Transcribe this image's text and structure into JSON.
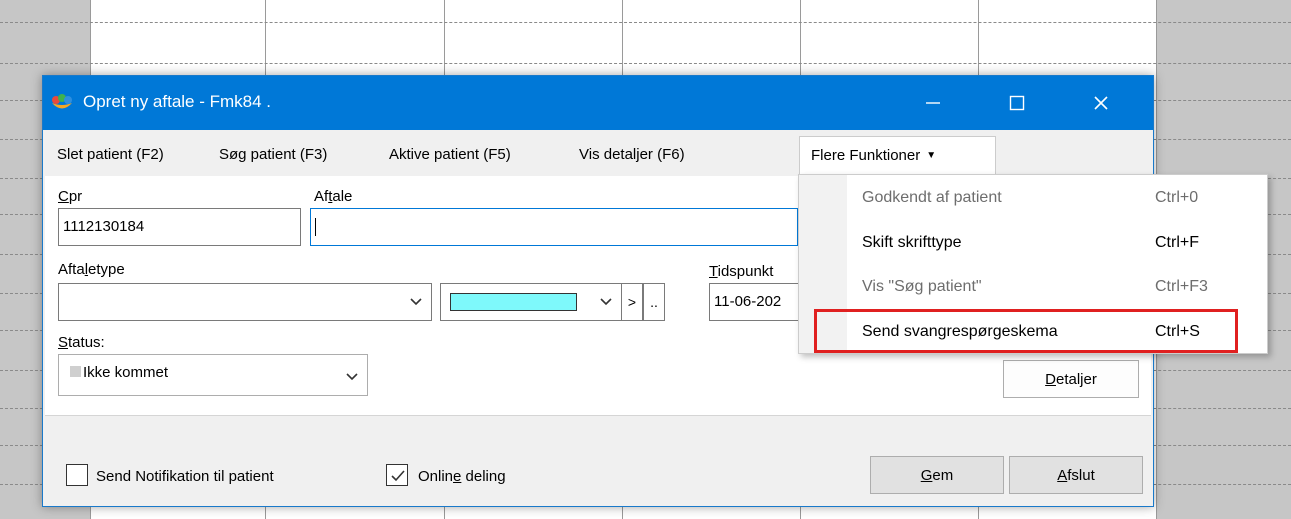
{
  "window": {
    "title": "Opret ny aftale - Fmk84 .",
    "minimize_glyph": "—",
    "maximize_glyph": "☐",
    "close_glyph": "✕"
  },
  "menubar": {
    "items": [
      {
        "label": "Slet patient (F2)"
      },
      {
        "label": "Søg patient (F3)"
      },
      {
        "label": "Aktive patient (F5)"
      },
      {
        "label": "Vis detaljer (F6)"
      }
    ],
    "more_label": "Flere Funktioner",
    "more_caret": "▼"
  },
  "dropdown": {
    "items": [
      {
        "label": "Godkendt af patient",
        "shortcut": "Ctrl+0",
        "enabled": false
      },
      {
        "label": "Skift skrifttype",
        "shortcut": "Ctrl+F",
        "enabled": true
      },
      {
        "label": "Vis \"Søg patient\"",
        "shortcut": "Ctrl+F3",
        "enabled": false
      },
      {
        "label": "Send svangrespørgeskema",
        "shortcut": "Ctrl+S",
        "enabled": true
      }
    ],
    "highlight_color": "#e02020"
  },
  "form": {
    "cpr_label_u": "C",
    "cpr_label_rest": "pr",
    "cpr_value": "1112130184",
    "aftale_label_a": "Af",
    "aftale_label_u": "t",
    "aftale_label_rest": "ale",
    "aftale_value": "",
    "aftaletype_label_a": "Afta",
    "aftaletype_label_u": "l",
    "aftaletype_label_rest": "etype",
    "aftaletype_value": "",
    "color_value": "#7ef9fb",
    "next_btn": ">",
    "more_btn": "..",
    "tidspunkt_label_u": "T",
    "tidspunkt_label_rest": "idspunkt",
    "tidspunkt_value": "11-06-202",
    "status_label_u": "S",
    "status_label_rest": "tatus:",
    "status_value": "Ikke kommet",
    "detaljer_u": "D",
    "detaljer_rest": "etaljer"
  },
  "footer": {
    "notify_label": "Send Notifikation til patient",
    "notify_checked": false,
    "online_label_a": "Onlin",
    "online_label_u": "e",
    "online_label_rest": " deling",
    "online_checked": true,
    "save_u": "G",
    "save_rest": "em",
    "close_u": "A",
    "close_rest": "fslut"
  },
  "colors": {
    "titlebar": "#0078d7",
    "color_swatch": "#7ef9fb"
  }
}
